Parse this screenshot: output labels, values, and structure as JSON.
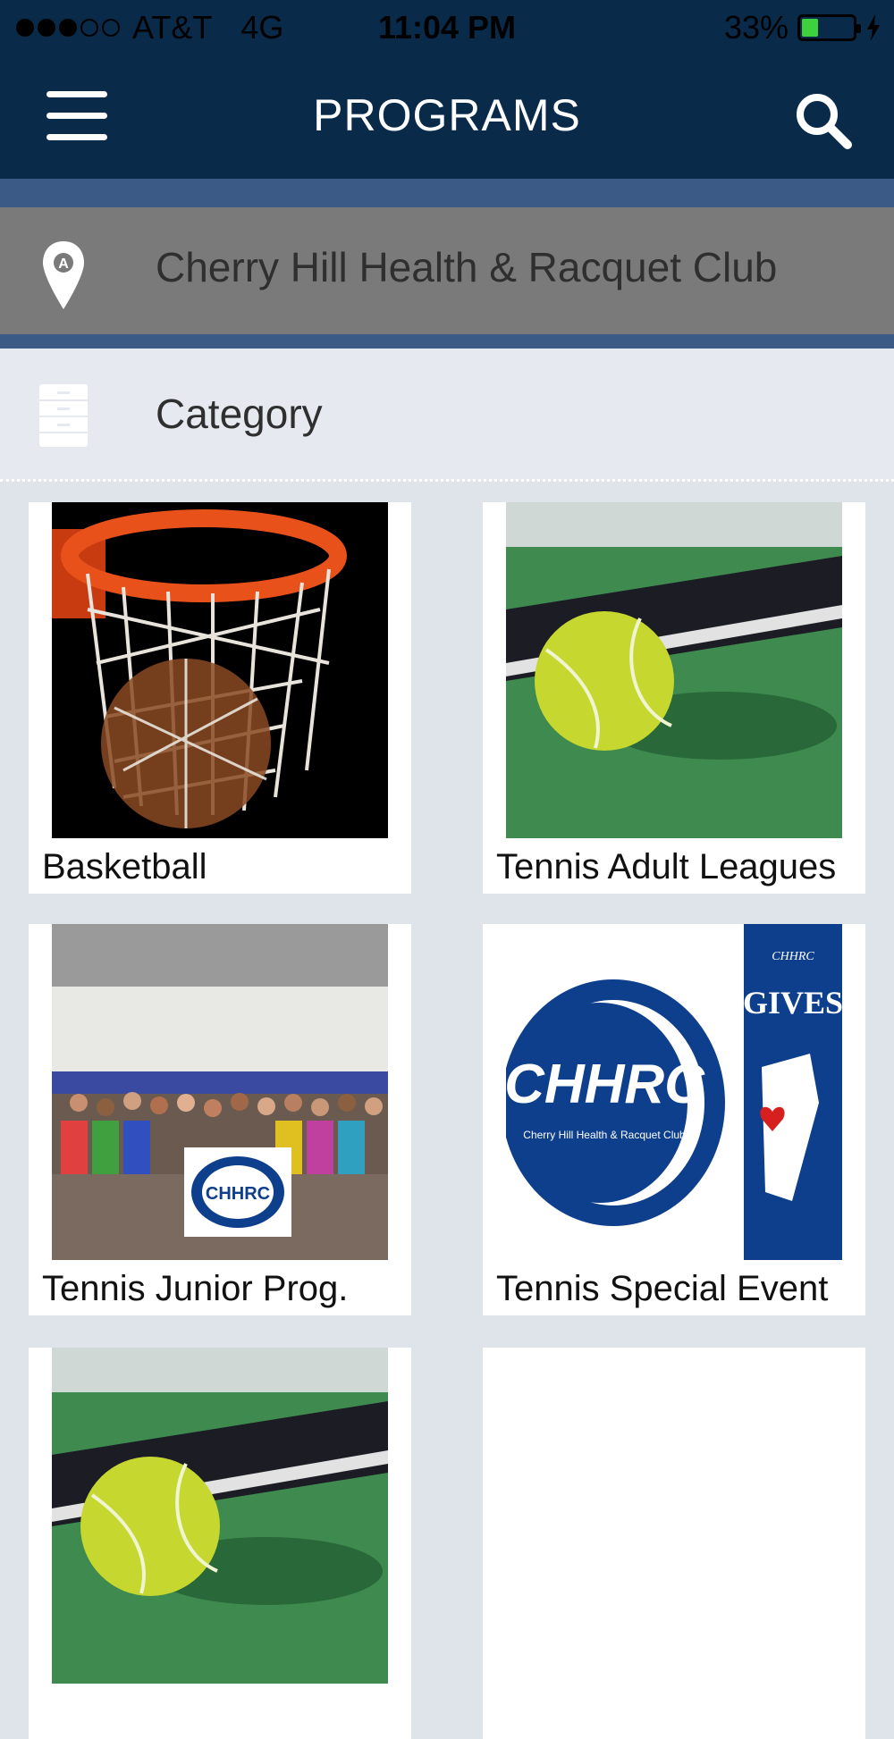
{
  "status_bar": {
    "carrier": "AT&T",
    "network": "4G",
    "time": "11:04 PM",
    "battery": "33%",
    "signal_bars": 3,
    "battery_level": 0.33
  },
  "header": {
    "title": "PROGRAMS",
    "menu_icon": "hamburger-icon",
    "search_icon": "search-icon"
  },
  "location": {
    "name": "Cherry Hill Health & Racquet Club",
    "icon": "map-pin-icon",
    "pin_letter": "A"
  },
  "category": {
    "label": "Category",
    "icon": "file-cabinet-icon"
  },
  "programs": [
    {
      "label": "Basketball",
      "image": "basketball-hoop-photo"
    },
    {
      "label": "Tennis Adult Leagues",
      "image": "tennis-racquet-ball-photo"
    },
    {
      "label": "Tennis Junior Prog.",
      "image": "group-photo-chhrc-banner"
    },
    {
      "label": "Tennis Special Event",
      "image": "chhrc-gives-logo"
    },
    {
      "label": "",
      "image": "tennis-racquet-ball-photo"
    },
    {
      "label": "",
      "image": ""
    }
  ],
  "logo_text": {
    "chhrc": "CHHRC",
    "club_name": "Cherry Hill Health & Racquet Club",
    "chhrc_small": "CHHRC",
    "gives": "GIVES"
  },
  "colors": {
    "header_bg": "#0a2a4a",
    "location_bg": "#7a7a7a",
    "battery_fill": "#3ed13e",
    "brand_blue": "#0e3f8c"
  }
}
